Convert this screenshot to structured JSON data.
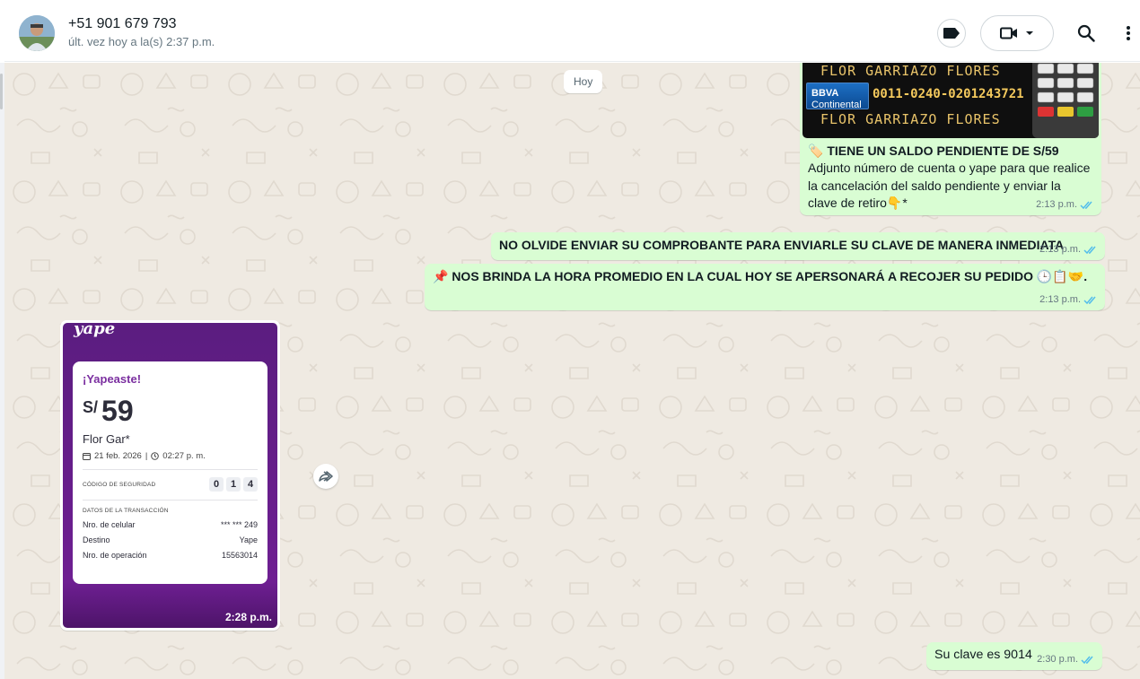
{
  "header": {
    "contact_name": "+51 901 679 793",
    "last_seen": "últ. vez hoy a la(s) 2:37 p.m."
  },
  "chat": {
    "day_divider": "Hoy",
    "messages": [
      {
        "type": "image_caption",
        "image": {
          "name_top": "FLOR GARRIAZO FLORES",
          "bank_name": "BBVA",
          "bank_subname": "Continental",
          "account_number": "0011-0240-0201243721",
          "name_bottom": "FLOR GARRIAZO FLORES"
        },
        "caption_title": "🏷️ TIENE UN SALDO PENDIENTE DE S/59",
        "caption_body": " Adjunto número de cuenta o yape para que realice la cancelación del saldo pendiente y enviar la clave de retiro👇*",
        "time": "2:13 p.m."
      },
      {
        "type": "text",
        "text": "NO OLVIDE ENVIAR SU COMPROBANTE PARA ENVIARLE SU CLAVE DE MANERA INMEDIATA",
        "time": "2:13 p.m."
      },
      {
        "type": "text",
        "text": "📌 NOS BRINDA LA HORA PROMEDIO EN LA CUAL HOY SE APERSONARÁ A RECOJER SU PEDIDO 🕒📋🤝.",
        "time": "2:13 p.m."
      },
      {
        "type": "image_incoming",
        "yape": {
          "logo": "yape",
          "title": "¡Yapeaste!",
          "currency": "S/",
          "amount": "59",
          "recipient": "Flor Gar*",
          "date": "21 feb. 2026",
          "time": "02:27 p. m.",
          "security_label": "CÓDIGO DE SEGURIDAD",
          "security_digits": [
            "0",
            "1",
            "4"
          ],
          "transaction_label": "DATOS DE LA TRANSACCIÓN",
          "rows": [
            {
              "label": "Nro. de celular",
              "value": "*** *** 249"
            },
            {
              "label": "Destino",
              "value": "Yape"
            },
            {
              "label": "Nro. de operación",
              "value": "15563014"
            }
          ]
        },
        "time": "2:28 p.m."
      },
      {
        "type": "text",
        "text": "Su clave es 9014",
        "time": "2:30 p.m."
      }
    ]
  },
  "colors": {
    "chat_background": "#efeae2",
    "outgoing_bubble": "#d9fdd3",
    "read_ticks": "#53bdeb",
    "yape_purple": "#6e1f92"
  },
  "icons": [
    "label-icon",
    "video-call-icon",
    "chevron-down-icon",
    "search-icon",
    "menu-icon",
    "forward-icon",
    "double-check-icon",
    "calendar-icon",
    "clock-icon"
  ]
}
